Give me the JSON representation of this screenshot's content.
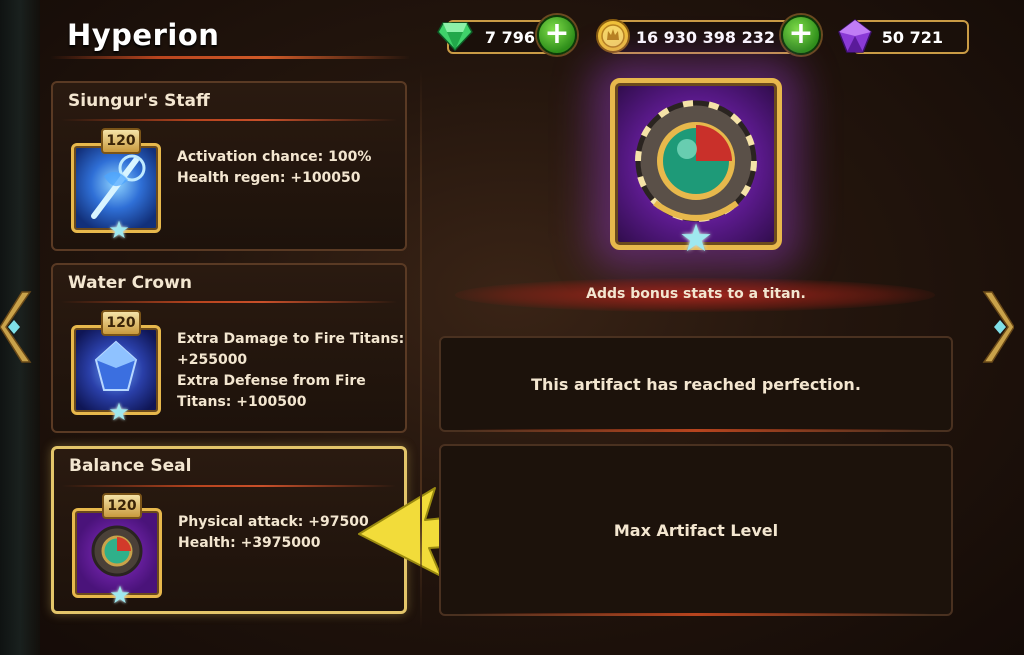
{
  "title": "Hyperion",
  "currencies": {
    "emeralds": "7 796",
    "gold": "16 930 398 232",
    "titanite": "50 721"
  },
  "artifacts": [
    {
      "name": "Siungur's Staff",
      "level": "120",
      "stats": [
        "Activation chance: 100%",
        "Health regen: +100050"
      ]
    },
    {
      "name": "Water Crown",
      "level": "120",
      "stats": [
        "Extra Damage to Fire Titans:",
        "+255000",
        "Extra Defense from Fire",
        "Titans: +100500"
      ]
    },
    {
      "name": "Balance Seal",
      "level": "120",
      "stats": [
        "Physical attack: +97500",
        "Health: +3975000"
      ]
    }
  ],
  "detail": {
    "description": "Adds bonus stats to a titan.",
    "perfection_text": "This artifact has reached perfection.",
    "max_level_text": "Max Artifact Level"
  },
  "colors": {
    "gold_border": "#e7b84c",
    "selected_border": "#e3c56a",
    "arrow_yellow": "#f2dc3a",
    "purple_glow": "#9a3ad8"
  },
  "icons": {
    "emerald": "emerald-icon",
    "gold": "gold-coin-icon",
    "titanite": "purple-crystal-icon",
    "plus": "plus-icon",
    "nav_left": "chevron-left-icon",
    "nav_right": "chevron-right-icon",
    "star": "star-icon"
  }
}
